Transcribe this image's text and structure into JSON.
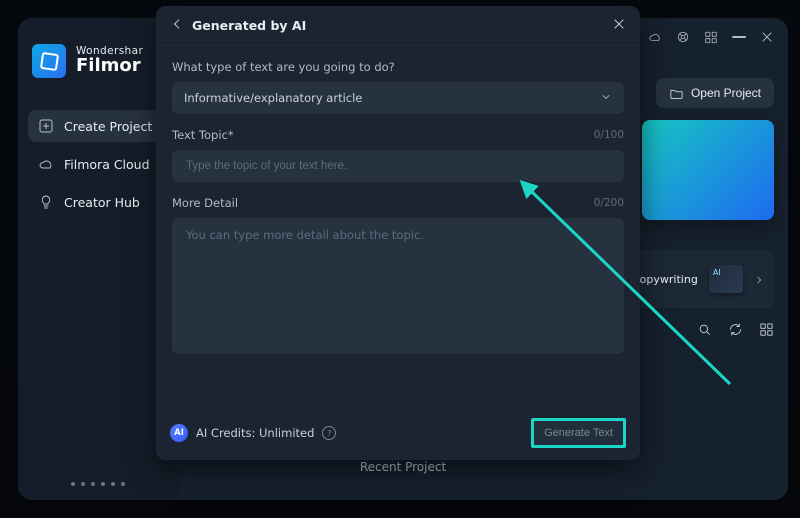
{
  "titlebar": {
    "icons": [
      "cloud-icon",
      "help-icon",
      "apps-icon",
      "minimize-icon",
      "close-icon"
    ]
  },
  "brand": {
    "top": "Wondershar",
    "bottom": "Filmor"
  },
  "sidebar": {
    "items": [
      {
        "icon": "plus-icon",
        "label": "Create Project",
        "active": true
      },
      {
        "icon": "cloud-icon",
        "label": "Filmora Cloud",
        "active": false
      },
      {
        "icon": "bulb-icon",
        "label": "Creator Hub",
        "active": false
      }
    ]
  },
  "right": {
    "open_project_label": "Open Project",
    "feature_label": "Copywriting",
    "row_icons": [
      "search-icon",
      "refresh-icon",
      "grid-icon"
    ]
  },
  "recent_label": "Recent Project",
  "modal": {
    "title": "Generated by AI",
    "question": "What type of text are you going to do?",
    "select_value": "Informative/explanatory article",
    "topic_label": "Text Topic*",
    "topic_counter": "0/100",
    "topic_placeholder": "Type the topic of your text here.",
    "detail_label": "More Detail",
    "detail_counter": "0/200",
    "detail_placeholder": "You can type more detail about the topic.",
    "credits_label": "AI Credits: Unlimited",
    "generate_label": "Generate Text"
  }
}
